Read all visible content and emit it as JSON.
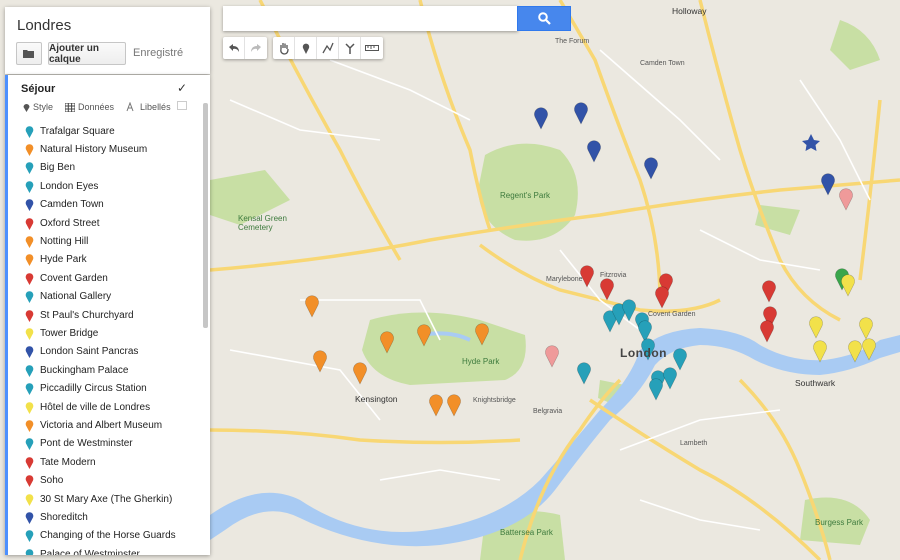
{
  "map": {
    "title": "Londres",
    "add_layer_label": "Ajouter un calque",
    "saved_label": "Enregistré",
    "layer": {
      "name": "Séjour",
      "tool_style": "Style",
      "tool_data": "Données",
      "tool_labels": "Libellés"
    },
    "places": [
      {
        "name": "Trafalgar Square",
        "color": "#26a0b9"
      },
      {
        "name": "Natural History Museum",
        "color": "#f28f28"
      },
      {
        "name": "Big Ben",
        "color": "#26a0b9"
      },
      {
        "name": "London Eyes",
        "color": "#26a0b9"
      },
      {
        "name": "Camden Town",
        "color": "#3253a8"
      },
      {
        "name": "Oxford Street",
        "color": "#d83a34"
      },
      {
        "name": "Notting Hill",
        "color": "#f28f28"
      },
      {
        "name": "Hyde Park",
        "color": "#f28f28"
      },
      {
        "name": "Covent Garden",
        "color": "#d83a34"
      },
      {
        "name": "National Gallery",
        "color": "#26a0b9"
      },
      {
        "name": "St Paul's Churchyard",
        "color": "#d83a34"
      },
      {
        "name": "Tower Bridge",
        "color": "#f2e14a"
      },
      {
        "name": "London Saint Pancras",
        "color": "#3253a8"
      },
      {
        "name": "Buckingham Palace",
        "color": "#26a0b9"
      },
      {
        "name": "Piccadilly Circus Station",
        "color": "#26a0b9"
      },
      {
        "name": "Hôtel de ville de Londres",
        "color": "#f2e14a"
      },
      {
        "name": "Victoria and Albert Museum",
        "color": "#f28f28"
      },
      {
        "name": "Pont de Westminster",
        "color": "#26a0b9"
      },
      {
        "name": "Tate Modern",
        "color": "#d83a34"
      },
      {
        "name": "Soho",
        "color": "#d83a34"
      },
      {
        "name": "30 St Mary Axe (The Gherkin)",
        "color": "#f2e14a"
      },
      {
        "name": "Shoreditch",
        "color": "#3253a8"
      },
      {
        "name": "Changing of the Horse Guards",
        "color": "#26a0b9"
      },
      {
        "name": "Palace of Westminster",
        "color": "#26a0b9"
      }
    ],
    "labels": {
      "city": "London",
      "kensington": "Kensington",
      "southwark": "Southwark",
      "hyde_park": "Hyde Park",
      "regents_park": "Regent's Park",
      "holloway": "Holloway",
      "battersea": "Battersea Park",
      "burgess": "Burgess Park",
      "kensal": "Kensal Green Cemetery",
      "marylebone": "Marylebone",
      "fitzrovia": "Fitzrovia",
      "covent": "Covent Garden",
      "knightsbridge": "Knightsbridge",
      "belgravia": "Belgravia",
      "lambeth": "Lambeth",
      "camden": "Camden Town",
      "forum": "The Forum"
    }
  }
}
